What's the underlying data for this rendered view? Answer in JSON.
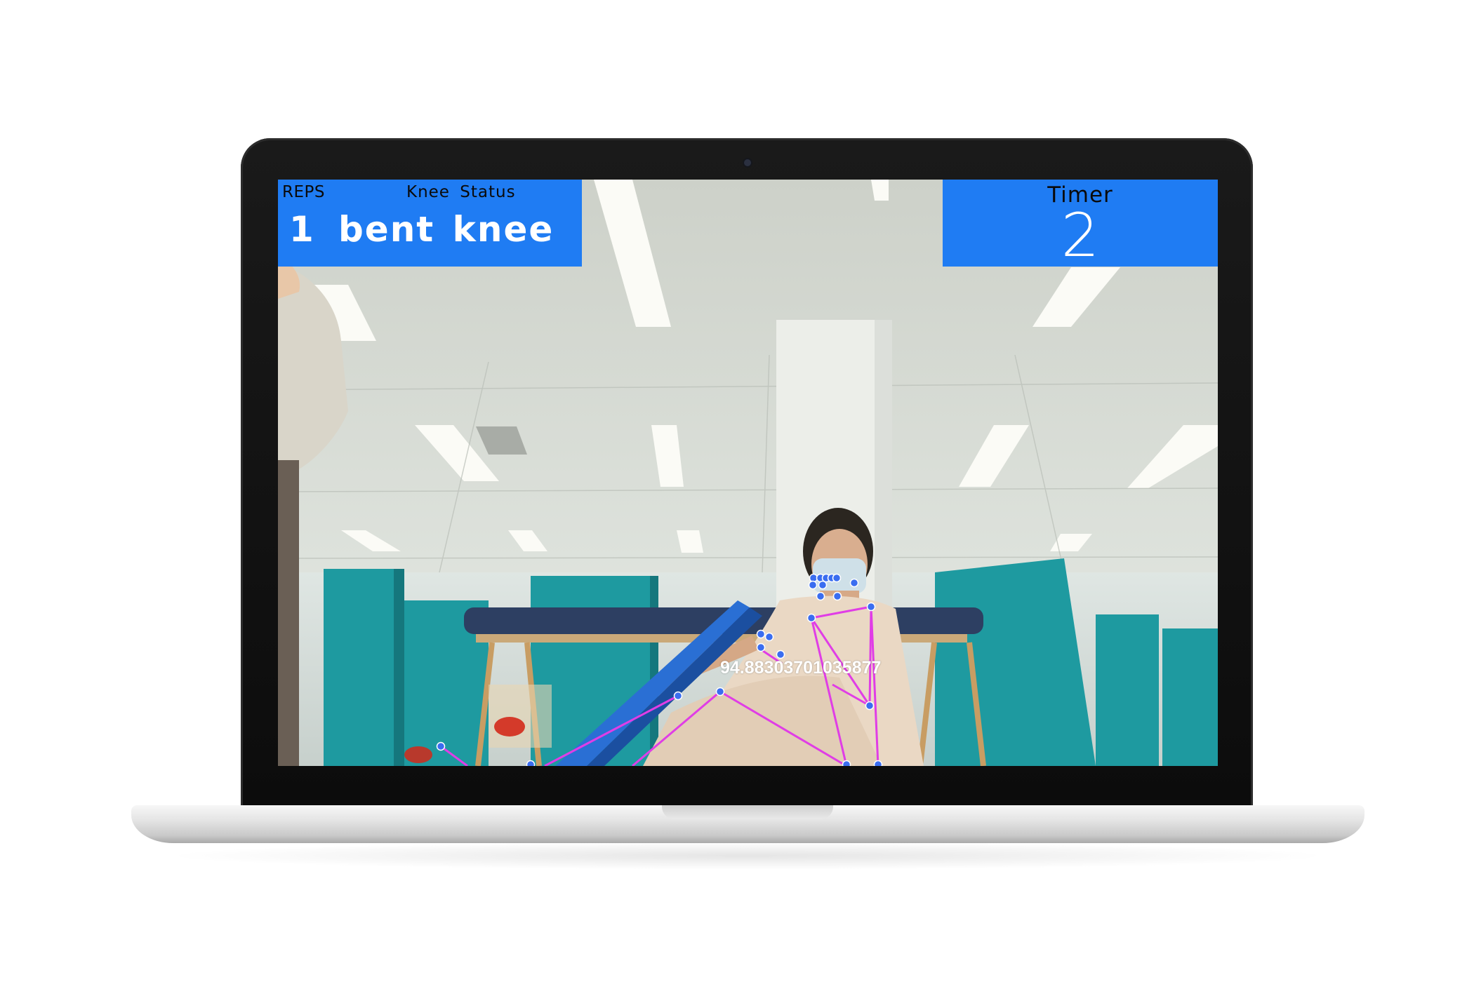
{
  "overlay": {
    "reps_label": "REPS",
    "knee_status_label": "Knee Status",
    "reps_value": "1",
    "knee_status_value": "bent knee",
    "timer_label": "Timer",
    "timer_value": "2",
    "angle_readout": "94.88303701035877"
  },
  "colors": {
    "panel": "#1f7cf3",
    "skeleton_line": "#e03de6",
    "landmark_dot": "#3a6df0"
  },
  "icons": {
    "webcam": "camera-lens-dot"
  }
}
